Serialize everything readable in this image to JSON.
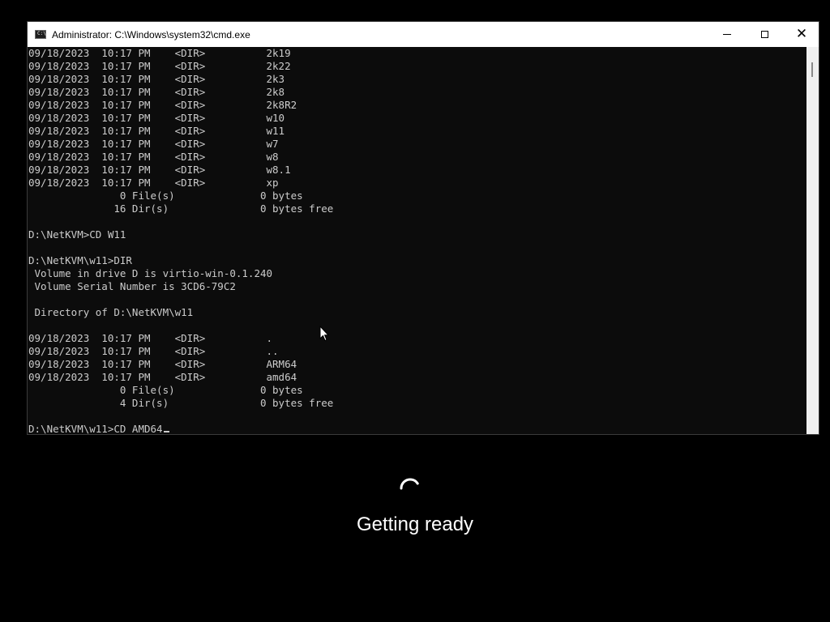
{
  "window": {
    "title": "Administrator: C:\\Windows\\system32\\cmd.exe",
    "title_icon_text": "C:\\",
    "close_glyph": "✕"
  },
  "console": {
    "lines": [
      "09/18/2023  10:17 PM    <DIR>          2k19",
      "09/18/2023  10:17 PM    <DIR>          2k22",
      "09/18/2023  10:17 PM    <DIR>          2k3",
      "09/18/2023  10:17 PM    <DIR>          2k8",
      "09/18/2023  10:17 PM    <DIR>          2k8R2",
      "09/18/2023  10:17 PM    <DIR>          w10",
      "09/18/2023  10:17 PM    <DIR>          w11",
      "09/18/2023  10:17 PM    <DIR>          w7",
      "09/18/2023  10:17 PM    <DIR>          w8",
      "09/18/2023  10:17 PM    <DIR>          w8.1",
      "09/18/2023  10:17 PM    <DIR>          xp",
      "               0 File(s)              0 bytes",
      "              16 Dir(s)               0 bytes free",
      "",
      "D:\\NetKVM>CD W11",
      "",
      "D:\\NetKVM\\w11>DIR",
      " Volume in drive D is virtio-win-0.1.240",
      " Volume Serial Number is 3CD6-79C2",
      "",
      " Directory of D:\\NetKVM\\w11",
      "",
      "09/18/2023  10:17 PM    <DIR>          .",
      "09/18/2023  10:17 PM    <DIR>          ..",
      "09/18/2023  10:17 PM    <DIR>          ARM64",
      "09/18/2023  10:17 PM    <DIR>          amd64",
      "               0 File(s)              0 bytes",
      "               4 Dir(s)               0 bytes free",
      ""
    ],
    "prompt": "D:\\NetKVM\\w11>CD AMD64"
  },
  "status": {
    "text": "Getting ready"
  },
  "colors": {
    "console_bg": "#0c0c0c",
    "console_fg": "#cccccc",
    "titlebar_bg": "#ffffff",
    "screen_bg": "#000000"
  },
  "icons": {
    "title_icon": "cmd-icon",
    "minimize": "minimize-icon",
    "maximize": "maximize-icon",
    "close": "close-icon",
    "pointer": "mouse-pointer-icon",
    "spinner": "loading-spinner-icon"
  }
}
